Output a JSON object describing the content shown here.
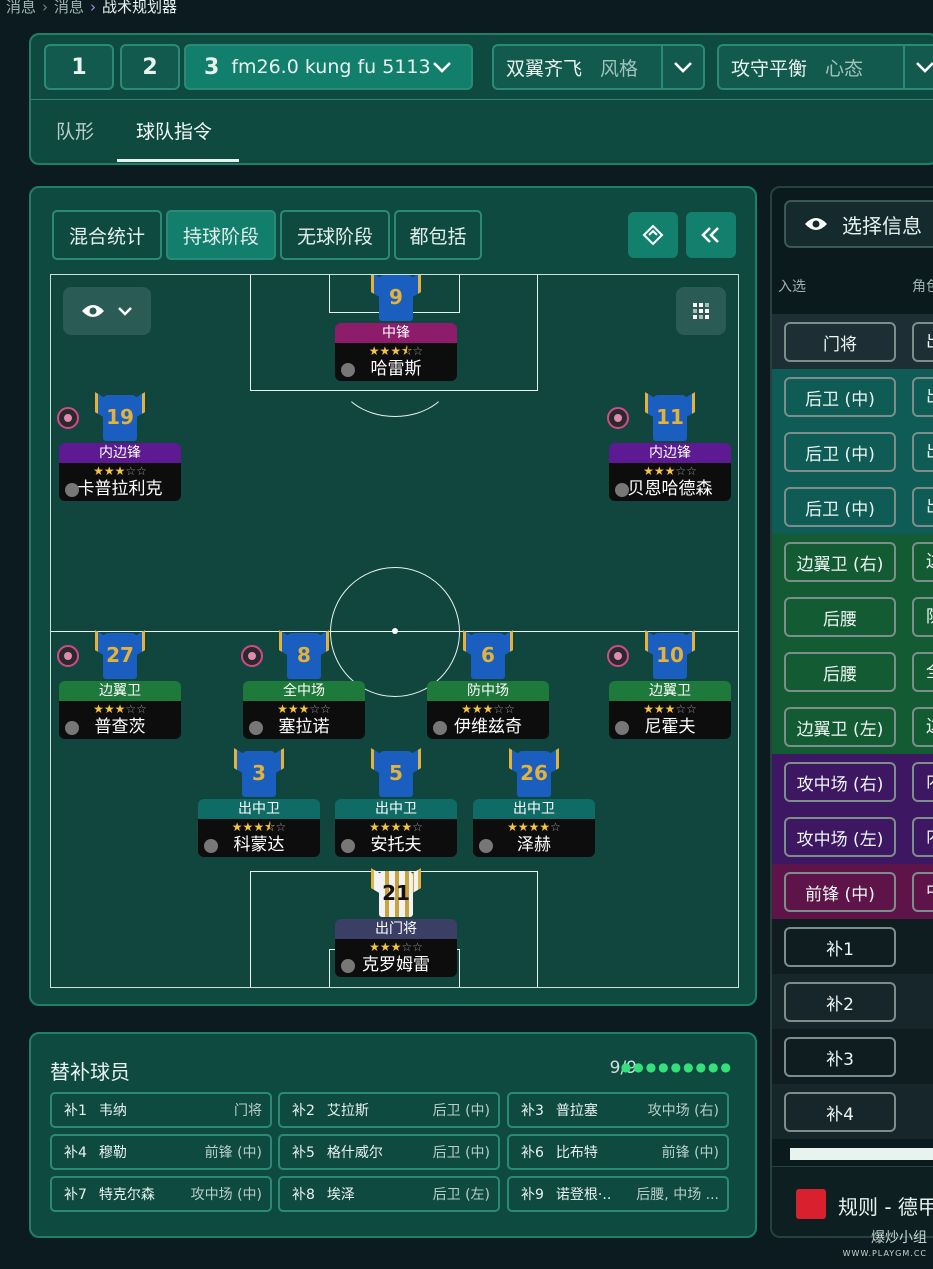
{
  "breadcrumb": {
    "items": [
      "消息",
      "消息",
      "战术规划器"
    ]
  },
  "tactic_slots": [
    {
      "num": "1"
    },
    {
      "num": "2"
    },
    {
      "num": "3",
      "name": "fm26.0 kung fu 5113"
    }
  ],
  "style_dropdown": {
    "value": "双翼齐飞",
    "label": "风格"
  },
  "mentality_dropdown": {
    "value": "攻守平衡",
    "label": "心态"
  },
  "top_tabs": [
    {
      "label": "队形"
    },
    {
      "label": "球队指令",
      "active": true
    }
  ],
  "phase_tabs": [
    {
      "label": "混合统计"
    },
    {
      "label": "持球阶段",
      "active": true
    },
    {
      "label": "无球阶段"
    },
    {
      "label": "都包括"
    }
  ],
  "players": [
    {
      "no": "9",
      "role": "中锋",
      "role_color": "#8d1c6b",
      "stars": 3.5,
      "name": "哈雷斯",
      "badge": false
    },
    {
      "no": "19",
      "role": "内边锋",
      "role_color": "#5e1a93",
      "stars": 3,
      "name": "卡普拉利克",
      "badge": true
    },
    {
      "no": "11",
      "role": "内边锋",
      "role_color": "#5e1a93",
      "stars": 3,
      "name": "贝恩哈德森",
      "badge": true
    },
    {
      "no": "27",
      "role": "边翼卫",
      "role_color": "#1e7a3a",
      "stars": 3,
      "name": "普查茨",
      "badge": true
    },
    {
      "no": "8",
      "role": "全中场",
      "role_color": "#1e7a3a",
      "stars": 3,
      "name": "塞拉诺",
      "badge": true
    },
    {
      "no": "6",
      "role": "防中场",
      "role_color": "#1e7a3a",
      "stars": 3,
      "name": "伊维兹奇",
      "badge": false
    },
    {
      "no": "10",
      "role": "边翼卫",
      "role_color": "#1e7a3a",
      "stars": 3,
      "name": "尼霍夫",
      "badge": true
    },
    {
      "no": "3",
      "role": "出中卫",
      "role_color": "#0f6b66",
      "stars": 3.5,
      "name": "科蒙达",
      "badge": false
    },
    {
      "no": "5",
      "role": "出中卫",
      "role_color": "#0f6b66",
      "stars": 4,
      "name": "安托夫",
      "badge": false
    },
    {
      "no": "26",
      "role": "出中卫",
      "role_color": "#0f6b66",
      "stars": 4,
      "name": "泽赫",
      "badge": false
    },
    {
      "no": "21",
      "role": "出门将",
      "role_color": "#3b3f66",
      "stars": 3,
      "name": "克罗姆雷",
      "badge": false,
      "gk": true
    }
  ],
  "subs": {
    "title": "替补球员",
    "count": "9/9",
    "items": [
      {
        "slot": "补1",
        "name": "韦纳",
        "role": "门将"
      },
      {
        "slot": "补2",
        "name": "艾拉斯",
        "role": "后卫 (中)"
      },
      {
        "slot": "补3",
        "name": "普拉塞",
        "role": "攻中场 (右)"
      },
      {
        "slot": "补4",
        "name": "穆勒",
        "role": "前锋 (中)"
      },
      {
        "slot": "补5",
        "name": "格什威尔",
        "role": "后卫 (中)"
      },
      {
        "slot": "补6",
        "name": "比布特",
        "role": "前锋 (中)"
      },
      {
        "slot": "补7",
        "name": "特克尔森",
        "role": "攻中场 (中)"
      },
      {
        "slot": "补8",
        "name": "埃泽",
        "role": "后卫 (左)"
      },
      {
        "slot": "补9",
        "name": "诺登根·..",
        "role": "后腰, 中场 ..."
      }
    ]
  },
  "selection": {
    "button": "选择信息",
    "headers": [
      "入选",
      "角色"
    ],
    "rows": [
      {
        "pos": "门将",
        "role": "出",
        "color": "#1d2e34"
      },
      {
        "pos": "后卫 (中)",
        "role": "出",
        "color": "#0f5b55"
      },
      {
        "pos": "后卫 (中)",
        "role": "出",
        "color": "#0f5b55"
      },
      {
        "pos": "后卫 (中)",
        "role": "出",
        "color": "#0f5b55"
      },
      {
        "pos": "边翼卫 (右)",
        "role": "边",
        "color": "#135c33"
      },
      {
        "pos": "后腰",
        "role": "防",
        "color": "#135c33"
      },
      {
        "pos": "后腰",
        "role": "全",
        "color": "#135c33"
      },
      {
        "pos": "边翼卫 (左)",
        "role": "边",
        "color": "#135c33"
      },
      {
        "pos": "攻中场 (右)",
        "role": "内",
        "color": "#3d1761"
      },
      {
        "pos": "攻中场 (左)",
        "role": "内",
        "color": "#3d1761"
      },
      {
        "pos": "前锋 (中)",
        "role": "中",
        "color": "#5e1448"
      },
      {
        "pos": "补1",
        "role": "",
        "color": "#0f1d21"
      },
      {
        "pos": "补2",
        "role": "",
        "color": "#16262a"
      },
      {
        "pos": "补3",
        "role": "",
        "color": "#0f1d21"
      },
      {
        "pos": "补4",
        "role": "",
        "color": "#16262a"
      }
    ]
  },
  "rule_bar": {
    "text": "规则 - 德甲"
  },
  "watermark": {
    "cn": "爆炒小组",
    "en": "WWW.PLAYGM.CC"
  }
}
